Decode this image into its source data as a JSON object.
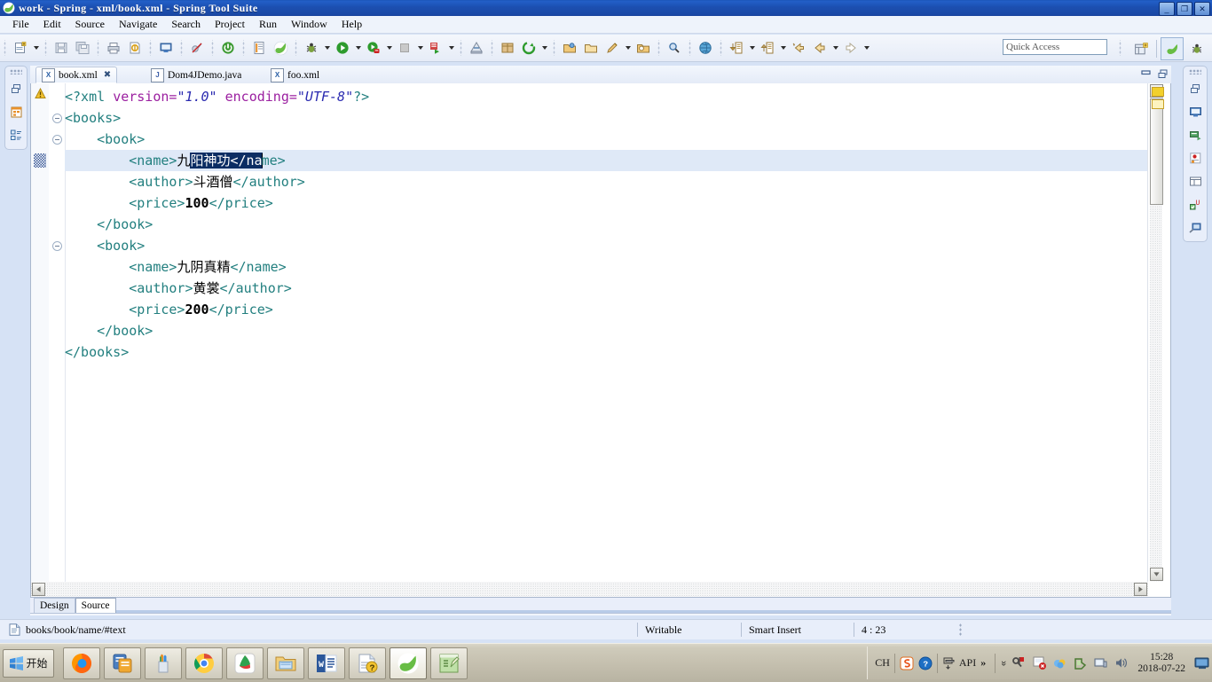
{
  "window": {
    "title": "work - Spring - xml/book.xml - Spring Tool Suite",
    "app_icon": "spring-leaf-icon",
    "minimize_label": "_",
    "maximize_label": "❐",
    "close_label": "✕"
  },
  "menubar": {
    "items": [
      {
        "label": "File",
        "name": "menu-file"
      },
      {
        "label": "Edit",
        "name": "menu-edit"
      },
      {
        "label": "Source",
        "name": "menu-source"
      },
      {
        "label": "Navigate",
        "name": "menu-navigate"
      },
      {
        "label": "Search",
        "name": "menu-search"
      },
      {
        "label": "Project",
        "name": "menu-project"
      },
      {
        "label": "Run",
        "name": "menu-run"
      },
      {
        "label": "Window",
        "name": "menu-window"
      },
      {
        "label": "Help",
        "name": "menu-help"
      }
    ]
  },
  "toolbar": {
    "quick_access_placeholder": "Quick Access",
    "quick_access_value": "",
    "buttons": [
      {
        "name": "new-wizard-button",
        "icon": "new-file-icon",
        "dropdown": true
      },
      {
        "name": "save-button",
        "icon": "save-icon",
        "dropdown": false
      },
      {
        "name": "save-all-button",
        "icon": "save-all-icon",
        "dropdown": false
      },
      {
        "name": "print-button",
        "icon": "print-icon",
        "dropdown": false
      },
      {
        "name": "validate-button",
        "icon": "validate-icon",
        "dropdown": false
      },
      {
        "name": "open-console-button",
        "icon": "console-icon",
        "dropdown": false
      },
      {
        "name": "skip-breakpoints-button",
        "icon": "skip-breakpoints-icon",
        "dropdown": false
      },
      {
        "name": "boot-dashboard-button",
        "icon": "power-icon",
        "dropdown": false
      },
      {
        "name": "new-spring-config-button",
        "icon": "spring-config-icon",
        "dropdown": false
      },
      {
        "name": "spring-button",
        "icon": "spring-leaf-icon",
        "dropdown": false
      },
      {
        "name": "debug-button",
        "icon": "bug-icon",
        "dropdown": true
      },
      {
        "name": "run-button",
        "icon": "run-icon",
        "dropdown": true
      },
      {
        "name": "run-external-tools-button",
        "icon": "external-tools-icon",
        "dropdown": true
      },
      {
        "name": "terminate-button",
        "icon": "terminate-icon",
        "dropdown": true
      },
      {
        "name": "coverage-button",
        "icon": "coverage-icon",
        "dropdown": true
      },
      {
        "name": "ant-build-button",
        "icon": "ant-icon",
        "dropdown": false
      },
      {
        "name": "new-package-button",
        "icon": "package-icon",
        "dropdown": false
      },
      {
        "name": "refresh-button",
        "icon": "refresh-icon",
        "dropdown": true
      },
      {
        "name": "open-type-button",
        "icon": "open-type-icon",
        "dropdown": false
      },
      {
        "name": "open-task-button",
        "icon": "open-task-icon",
        "dropdown": false
      },
      {
        "name": "new-task-button",
        "icon": "pencil-icon",
        "dropdown": true
      },
      {
        "name": "open-resource-button",
        "icon": "open-resource-icon",
        "dropdown": false
      },
      {
        "name": "search-button",
        "icon": "search-icon",
        "dropdown": false
      },
      {
        "name": "open-web-browser-button",
        "icon": "globe-icon",
        "dropdown": false
      },
      {
        "name": "next-annotation-button",
        "icon": "next-annotation-icon",
        "dropdown": true
      },
      {
        "name": "prev-annotation-button",
        "icon": "prev-annotation-icon",
        "dropdown": true
      },
      {
        "name": "last-edit-button",
        "icon": "last-edit-icon",
        "dropdown": false
      },
      {
        "name": "back-button",
        "icon": "back-arrow-icon",
        "dropdown": true
      },
      {
        "name": "forward-button",
        "icon": "forward-arrow-icon",
        "dropdown": true
      }
    ],
    "perspective": [
      {
        "name": "open-perspective-button",
        "icon": "open-perspective-icon"
      },
      {
        "name": "perspective-spring",
        "icon": "spring-leaf-icon",
        "selected": true
      },
      {
        "name": "perspective-debug",
        "icon": "bug-icon",
        "selected": false
      }
    ]
  },
  "left_rail": {
    "buttons": [
      {
        "name": "restore-view-button",
        "icon": "restore-icon"
      },
      {
        "name": "package-explorer-button",
        "icon": "package-explorer-icon"
      },
      {
        "name": "outline-view-button",
        "icon": "outline-icon"
      }
    ]
  },
  "right_rail": {
    "buttons": [
      {
        "name": "restore-view-button",
        "icon": "restore-icon"
      },
      {
        "name": "console-view-button",
        "icon": "console-icon"
      },
      {
        "name": "servers-view-button",
        "icon": "servers-icon"
      },
      {
        "name": "boot-dashboard-button",
        "icon": "boot-dashboard-icon"
      },
      {
        "name": "properties-view-button",
        "icon": "properties-table-icon"
      },
      {
        "name": "junit-view-button",
        "icon": "junit-icon"
      },
      {
        "name": "debug-view-button",
        "icon": "debug-view-icon"
      }
    ]
  },
  "editor": {
    "tabs": [
      {
        "label": "book.xml",
        "icon": "xml-file-icon",
        "active": true,
        "close": "✖",
        "name": "tab-book-xml"
      },
      {
        "label": "Dom4JDemo.java",
        "icon": "java-file-icon",
        "active": false,
        "close": "",
        "name": "tab-dom4jdemo-java"
      },
      {
        "label": "foo.xml",
        "icon": "xml-file-icon",
        "active": false,
        "close": "",
        "name": "tab-foo-xml"
      }
    ],
    "part_buttons": [
      {
        "name": "minimize-editor-button",
        "icon": "minimize-icon"
      },
      {
        "name": "maximize-editor-button",
        "icon": "maximize-icon"
      }
    ],
    "current_line": 4,
    "selection_text": "阳神功</na",
    "bottom_tabs": [
      {
        "label": "Design",
        "active": false,
        "name": "tab-design"
      },
      {
        "label": "Source",
        "active": true,
        "name": "tab-source"
      }
    ],
    "code_lines": [
      {
        "indent": 0,
        "marker": "warning",
        "fold": null,
        "tokens": [
          {
            "t": "pi",
            "v": "<?xml "
          },
          {
            "t": "attr",
            "v": "version="
          },
          {
            "t": "val",
            "v": "\"1.0\""
          },
          {
            "t": "pi",
            "v": " "
          },
          {
            "t": "attr",
            "v": "encoding="
          },
          {
            "t": "val",
            "v": "\"UTF-8\""
          },
          {
            "t": "pi",
            "v": "?>"
          }
        ]
      },
      {
        "indent": 0,
        "marker": null,
        "fold": "collapse",
        "tokens": [
          {
            "t": "tag",
            "v": "<books>"
          }
        ]
      },
      {
        "indent": 1,
        "marker": null,
        "fold": "collapse",
        "tokens": [
          {
            "t": "tag",
            "v": "<book>"
          }
        ]
      },
      {
        "indent": 2,
        "marker": "current",
        "fold": null,
        "tokens": [
          {
            "t": "tag",
            "v": "<name>"
          },
          {
            "t": "txt",
            "v": "九"
          },
          {
            "t": "sel",
            "v": "阳神功</na"
          },
          {
            "t": "tag",
            "v": "me>"
          }
        ]
      },
      {
        "indent": 2,
        "marker": null,
        "fold": null,
        "tokens": [
          {
            "t": "tag",
            "v": "<author>"
          },
          {
            "t": "txt",
            "v": "斗酒僧"
          },
          {
            "t": "tag",
            "v": "</author>"
          }
        ]
      },
      {
        "indent": 2,
        "marker": null,
        "fold": null,
        "tokens": [
          {
            "t": "tag",
            "v": "<price>"
          },
          {
            "t": "num",
            "v": "100"
          },
          {
            "t": "tag",
            "v": "</price>"
          }
        ]
      },
      {
        "indent": 1,
        "marker": null,
        "fold": null,
        "tokens": [
          {
            "t": "tag",
            "v": "</book>"
          }
        ]
      },
      {
        "indent": 1,
        "marker": null,
        "fold": "collapse",
        "tokens": [
          {
            "t": "tag",
            "v": "<book>"
          }
        ]
      },
      {
        "indent": 2,
        "marker": null,
        "fold": null,
        "tokens": [
          {
            "t": "tag",
            "v": "<name>"
          },
          {
            "t": "txt",
            "v": "九阴真精"
          },
          {
            "t": "tag",
            "v": "</name>"
          }
        ]
      },
      {
        "indent": 2,
        "marker": null,
        "fold": null,
        "tokens": [
          {
            "t": "tag",
            "v": "<author>"
          },
          {
            "t": "txt",
            "v": "黄裳"
          },
          {
            "t": "tag",
            "v": "</author>"
          }
        ]
      },
      {
        "indent": 2,
        "marker": null,
        "fold": null,
        "tokens": [
          {
            "t": "tag",
            "v": "<price>"
          },
          {
            "t": "num",
            "v": "200"
          },
          {
            "t": "tag",
            "v": "</price>"
          }
        ]
      },
      {
        "indent": 1,
        "marker": null,
        "fold": null,
        "tokens": [
          {
            "t": "tag",
            "v": "</book>"
          }
        ]
      },
      {
        "indent": 0,
        "marker": null,
        "fold": null,
        "tokens": [
          {
            "t": "tag",
            "v": "</books>"
          }
        ]
      }
    ]
  },
  "statusbar": {
    "path": "books/book/name/#text",
    "path_icon": "document-icon",
    "writable": "Writable",
    "insert_mode": "Smart Insert",
    "position": "4 : 23"
  },
  "taskbar": {
    "start_label": "开始",
    "start_icon": "windows-flag-icon",
    "items": [
      {
        "name": "taskbar-firefox",
        "icon": "firefox-icon",
        "active": false
      },
      {
        "name": "taskbar-eclipse-x",
        "icon": "blue-doc-icon",
        "active": false
      },
      {
        "name": "taskbar-brushes",
        "icon": "pencil-cup-icon",
        "active": false
      },
      {
        "name": "taskbar-chrome",
        "icon": "chrome-icon",
        "active": false
      },
      {
        "name": "taskbar-pdf",
        "icon": "foxit-pdf-icon",
        "active": false
      },
      {
        "name": "taskbar-explorer",
        "icon": "folder-icon",
        "active": false
      },
      {
        "name": "taskbar-word",
        "icon": "word-icon",
        "active": false
      },
      {
        "name": "taskbar-chm",
        "icon": "help-doc-icon",
        "active": false
      },
      {
        "name": "taskbar-sts",
        "icon": "spring-leaf-icon",
        "active": true
      },
      {
        "name": "taskbar-editor",
        "icon": "notepad-icon",
        "active": false
      }
    ],
    "tray": {
      "ime_lang": "CH",
      "ime_icons": [
        "sogou-icon",
        "help-icon",
        "keyboard-icon"
      ],
      "api_label": "API",
      "overflow": "»",
      "expand": "«",
      "icons": [
        "security-key-icon",
        "flag-icon",
        "network-error-icon",
        "cloud-icon",
        "shield-icon",
        "monitor-icon",
        "volume-icon"
      ],
      "time": "15:28",
      "date": "2018-07-22",
      "show_desktop": "show-desktop-icon"
    }
  }
}
